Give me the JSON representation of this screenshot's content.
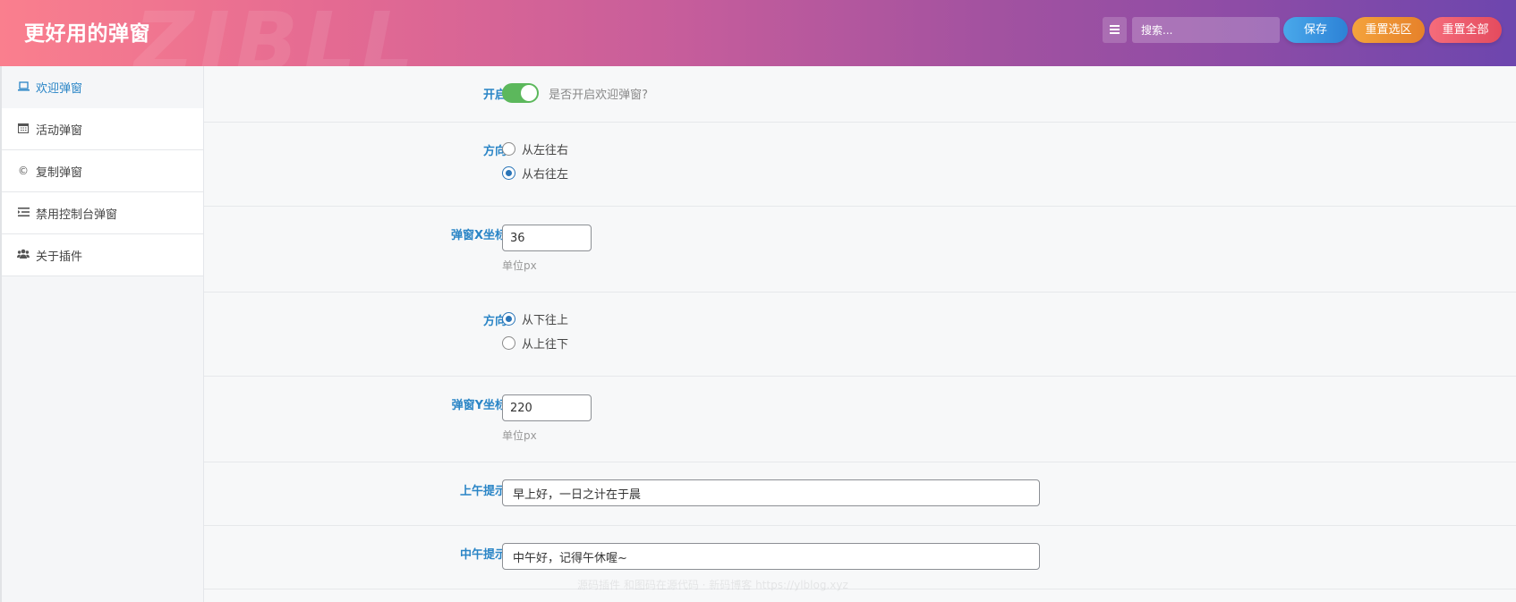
{
  "header": {
    "title": "更好用的弹窗",
    "watermark": "ZIBLL",
    "search_placeholder": "搜索...",
    "save_label": "保存",
    "reset_section_label": "重置选区",
    "reset_all_label": "重置全部"
  },
  "sidebar": {
    "items": [
      {
        "icon": "laptop-icon",
        "label": "欢迎弹窗",
        "active": true
      },
      {
        "icon": "calendar-icon",
        "label": "活动弹窗",
        "active": false
      },
      {
        "icon": "copyright-icon",
        "label": "复制弹窗",
        "active": false
      },
      {
        "icon": "indent-list-icon",
        "label": "禁用控制台弹窗",
        "active": false
      },
      {
        "icon": "users-icon",
        "label": "关于插件",
        "active": false
      }
    ]
  },
  "form": {
    "enable": {
      "label": "开启",
      "hint": "是否开启欢迎弹窗?",
      "value": true
    },
    "direction_x": {
      "label": "方向",
      "options": [
        "从左往右",
        "从右往左"
      ],
      "selected": "从右往左"
    },
    "x_coord": {
      "label": "弹窗X坐标",
      "value": "36",
      "unit": "单位px"
    },
    "direction_y": {
      "label": "方向",
      "options": [
        "从下往上",
        "从上往下"
      ],
      "selected": "从下往上"
    },
    "y_coord": {
      "label": "弹窗Y坐标",
      "value": "220",
      "unit": "单位px"
    },
    "morning": {
      "label": "上午提示",
      "value": "早上好，一日之计在于晨"
    },
    "noon": {
      "label": "中午提示",
      "value": "中午好，记得午休喔~"
    }
  },
  "footer_watermark": "源码插件 和图码在源代码 · 新码博客 https://ylblog.xyz",
  "colors": {
    "accent": "#2a85c6",
    "toggle_on": "#5cb85c"
  }
}
